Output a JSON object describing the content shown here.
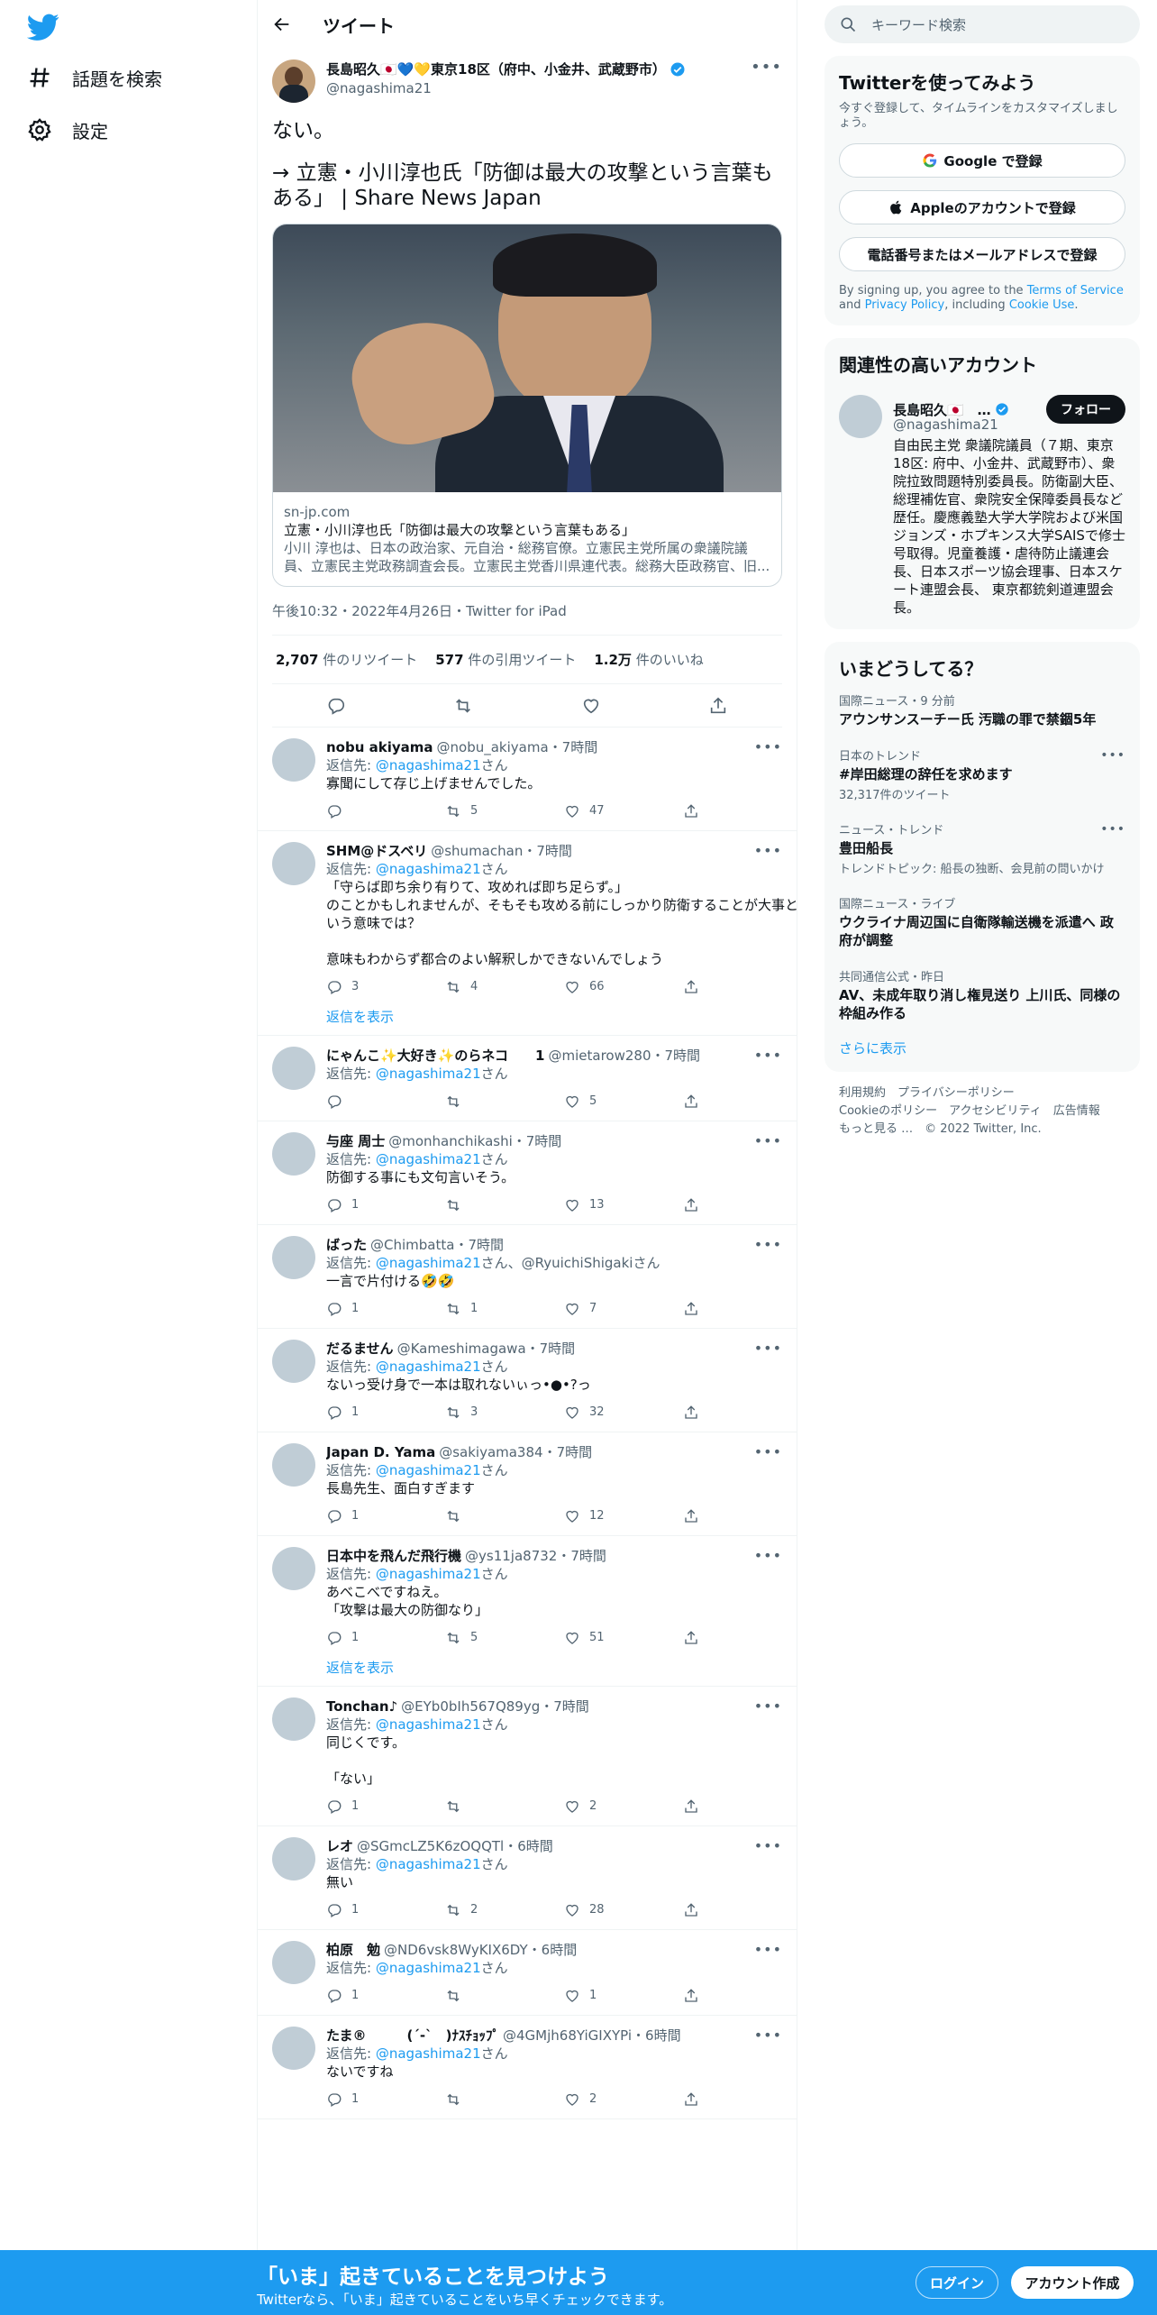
{
  "nav": {
    "explore": "話題を検索",
    "settings": "設定"
  },
  "header": {
    "title": "ツイート"
  },
  "tweet": {
    "name": "長島昭久🇯🇵💙💛東京18区（府中、小金井、武蔵野市）",
    "handle": "@nagashima21",
    "text": "ない。",
    "link_text": "→ 立憲・小川淳也氏「防御は最大の攻撃という言葉もある」 | Share News Japan",
    "card": {
      "domain": "sn-jp.com",
      "title": "立憲・小川淳也氏「防御は最大の攻撃という言葉もある」",
      "desc": "小川 淳也は、日本の政治家、元自治・総務官僚。立憲民主党所属の衆議院議員、立憲民主党政務調査会長。立憲民主党香川県連代表。総務大臣政務官、旧..."
    },
    "meta": "午後10:32・2022年4月26日・Twitter for iPad",
    "stats": {
      "retweets": "2,707",
      "retweets_label": "件のリツイート",
      "quotes": "577",
      "quotes_label": "件の引用ツイート",
      "likes": "1.2万",
      "likes_label": "件のいいね"
    }
  },
  "replies": [
    {
      "name": "nobu akiyama",
      "handle": "@nobu_akiyama",
      "time": "・7時間",
      "to_prefix": "返信先: ",
      "to": "@nagashima21",
      "to_suffix": "さん",
      "text": "寡聞にして存じ上げませんでした。",
      "reply_count": "",
      "rt_count": "5",
      "like_count": "47",
      "show_replies": ""
    },
    {
      "name": "SHM@ドスベリ",
      "handle": "@shumachan",
      "time": "・7時間",
      "to_prefix": "返信先: ",
      "to": "@nagashima21",
      "to_suffix": "さん",
      "text": "「守らば即ち余り有りて、攻めれば即ち足らず。」\nのことかもしれませんが、そもそも攻める前にしっかり防衛することが大事という意味では？\n\n意味もわからず都合のよい解釈しかできないんでしょう",
      "reply_count": "3",
      "rt_count": "4",
      "like_count": "66",
      "show_replies": "返信を表示"
    },
    {
      "name": "にゃんこ✨大好き✨のらネコ　　1",
      "handle": "@mietarow280",
      "time": "・7時間",
      "to_prefix": "返信先: ",
      "to": "@nagashima21",
      "to_suffix": "さん",
      "text": "",
      "reply_count": "",
      "rt_count": "",
      "like_count": "5",
      "show_replies": ""
    },
    {
      "name": "与座 周士",
      "handle": "@monhanchikashi",
      "time": "・7時間",
      "to_prefix": "返信先: ",
      "to": "@nagashima21",
      "to_suffix": "さん",
      "text": "防御する事にも文句言いそう。",
      "reply_count": "1",
      "rt_count": "",
      "like_count": "13",
      "show_replies": ""
    },
    {
      "name": "ばった",
      "handle": "@Chimbatta",
      "time": "・7時間",
      "to_prefix": "返信先: ",
      "to": "@nagashima21",
      "to_suffix": "さん、@RyuichiShigakiさん",
      "text": "一言で片付ける🤣🤣",
      "reply_count": "1",
      "rt_count": "1",
      "like_count": "7",
      "show_replies": ""
    },
    {
      "name": "だるません",
      "handle": "@Kameshimagawa",
      "time": "・7時間",
      "to_prefix": "返信先: ",
      "to": "@nagashima21",
      "to_suffix": "さん",
      "text": "ないっ受け身で一本は取れないぃっ•●•?っ",
      "reply_count": "1",
      "rt_count": "3",
      "like_count": "32",
      "show_replies": ""
    },
    {
      "name": "Japan D. Yama",
      "handle": "@sakiyama384",
      "time": "・7時間",
      "to_prefix": "返信先: ",
      "to": "@nagashima21",
      "to_suffix": "さん",
      "text": "長島先生、面白すぎます",
      "reply_count": "1",
      "rt_count": "",
      "like_count": "12",
      "show_replies": ""
    },
    {
      "name": "日本中を飛んだ飛行機",
      "handle": "@ys11ja8732",
      "time": "・7時間",
      "to_prefix": "返信先: ",
      "to": "@nagashima21",
      "to_suffix": "さん",
      "text": "あべこべですねえ。\n「攻撃は最大の防御なり」",
      "reply_count": "1",
      "rt_count": "5",
      "like_count": "51",
      "show_replies": "返信を表示"
    },
    {
      "name": "Tonchan♪",
      "handle": "@EYb0bIh567Q89yg",
      "time": "・7時間",
      "to_prefix": "返信先: ",
      "to": "@nagashima21",
      "to_suffix": "さん",
      "text": "同じくです。\n\n「ない」",
      "reply_count": "1",
      "rt_count": "",
      "like_count": "2",
      "show_replies": ""
    },
    {
      "name": "レオ",
      "handle": "@SGmcLZ5K6zOQQTl",
      "time": "・6時間",
      "to_prefix": "返信先: ",
      "to": "@nagashima21",
      "to_suffix": "さん",
      "text": "無い",
      "reply_count": "1",
      "rt_count": "2",
      "like_count": "28",
      "show_replies": ""
    },
    {
      "name": "柏原　勉",
      "handle": "@ND6vsk8WyKIX6DY",
      "time": "・6時間",
      "to_prefix": "返信先: ",
      "to": "@nagashima21",
      "to_suffix": "さん",
      "text": "",
      "reply_count": "1",
      "rt_count": "",
      "like_count": "1",
      "show_replies": ""
    },
    {
      "name": "たま®　　　(ˊ-ˋ　)ﾅｽﾁｮｯﾌﾟ",
      "handle": "@4GMjh68YiGIXYPi",
      "time": "・6時間",
      "to_prefix": "返信先: ",
      "to": "@nagashima21",
      "to_suffix": "さん",
      "text": "ないですね",
      "reply_count": "1",
      "rt_count": "",
      "like_count": "2",
      "show_replies": ""
    }
  ],
  "right": {
    "search_placeholder": "キーワード検索",
    "signup": {
      "title": "Twitterを使ってみよう",
      "desc": "今すぐ登録して、タイムラインをカスタマイズしましょう。",
      "google": "Google で登録",
      "apple": "Appleのアカウントで登録",
      "phone": "電話番号またはメールアドレスで登録",
      "terms_1": "By signing up, you agree to the ",
      "terms_link1": "Terms of Service",
      "terms_2": " and ",
      "terms_link2": "Privacy Policy",
      "terms_3": ", including ",
      "terms_link3": "Cookie Use",
      "terms_4": "."
    },
    "related": {
      "title": "関連性の高いアカウント",
      "name": "長島昭久🇯🇵　…",
      "handle": "@nagashima21",
      "follow": "フォロー",
      "bio": "自由民主党 衆議院議員（７期、東京18区: 府中、小金井、武蔵野市）、衆院拉致問題特別委員長。防衛副大臣、総理補佐官、衆院安全保障委員長など歴任。慶應義塾大学大学院および米国ジョンズ・ホプキンス大学SAISで修士号取得。児童養護・虐待防止議連会長、日本スポーツ協会理事、日本スケート連盟会長、 東京都銃剣道連盟会長。"
    },
    "trends": {
      "title": "いまどうしてる？",
      "items": [
        {
          "context": "国際ニュース・9 分前",
          "title": "アウンサンスーチー氏 汚職の罪で禁錮5年",
          "sub": ""
        },
        {
          "context": "日本のトレンド",
          "title": "#岸田総理の辞任を求めます",
          "sub": "32,317件のツイート"
        },
        {
          "context": "ニュース・トレンド",
          "title": "豊田船長",
          "sub": "トレンドトピック: 船長の独断、会見前の問いかけ"
        },
        {
          "context": "国際ニュース・ライブ",
          "title": "ウクライナ周辺国に自衛隊輸送機を派遣へ 政府が調整",
          "sub": ""
        },
        {
          "context": "共同通信公式・昨日",
          "title": "AV、未成年取り消し権見送り 上川氏、同様の枠組み作る",
          "sub": ""
        }
      ],
      "show_more": "さらに表示"
    },
    "footer": {
      "line1": "利用規約　プライバシーポリシー",
      "line2": "Cookieのポリシー　アクセシビリティ　広告情報",
      "line3": "もっと見る …　© 2022 Twitter, Inc."
    }
  },
  "bottombar": {
    "title": "「いま」起きていることを見つけよう",
    "sub": "Twitterなら、「いま」起きていることをいち早くチェックできます。",
    "login": "ログイン",
    "signup": "アカウント作成"
  },
  "colors": {
    "accent": "#1d9bf0",
    "text": "#0f1419",
    "muted": "#536471"
  }
}
